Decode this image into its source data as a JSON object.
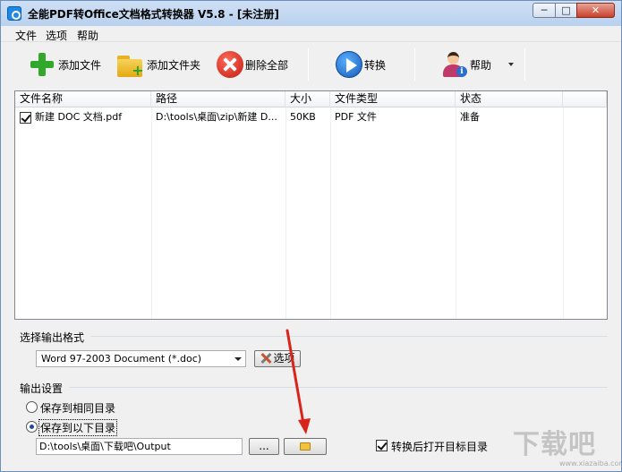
{
  "window": {
    "title": "全能PDF转Office文档格式转换器 V5.8  -  [未注册]",
    "controls": {
      "minimize": "─",
      "maximize": "□",
      "close": "✕"
    }
  },
  "menu": [
    {
      "label": "文件"
    },
    {
      "label": "选项"
    },
    {
      "label": "帮助"
    }
  ],
  "toolbar": {
    "add_file": "添加文件",
    "add_folder": "添加文件夹",
    "delete_all": "删除全部",
    "convert": "转换",
    "help": "帮助",
    "icons": {
      "add_file": "plus-icon",
      "add_folder": "folder-add-icon",
      "delete_all": "delete-icon",
      "convert": "play-icon",
      "help": "user-help-icon"
    }
  },
  "file_list": {
    "columns": [
      "文件名称",
      "路径",
      "大小",
      "文件类型",
      "状态"
    ],
    "rows": [
      {
        "checked": true,
        "name": "新建 DOC 文档.pdf",
        "path": "D:\\tools\\桌面\\zip\\新建 D...",
        "size": "50KB",
        "type": "PDF 文件",
        "status": "准备"
      }
    ]
  },
  "output_format": {
    "group_label": "选择输出格式",
    "selected": "Word 97-2003 Document (*.doc)",
    "options_button": "选项"
  },
  "output_settings": {
    "group_label": "输出设置",
    "same_dir_label": "保存到相同目录",
    "custom_dir_label": "保存到以下目录",
    "selected": "custom",
    "path": "D:\\tools\\桌面\\下载吧\\Output",
    "browse_button": "...",
    "open_after_label": "转换后打开目标目录",
    "open_after_checked": true
  },
  "watermark": {
    "text": "下载吧",
    "sub": "www.xiazaiba.com"
  },
  "colors": {
    "arrow": "#d9241b",
    "titlebar": "#c4d8f1",
    "accent": "#1659b8"
  }
}
